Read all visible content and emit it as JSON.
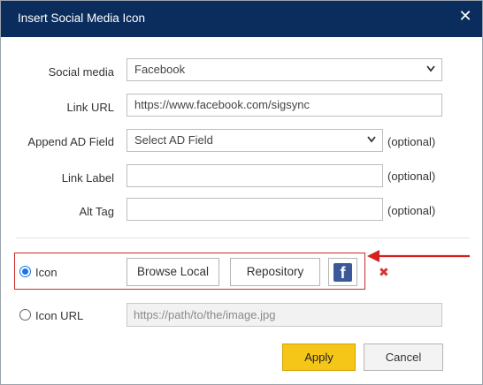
{
  "dialog": {
    "title": "Insert Social Media Icon",
    "close_icon": "close-icon"
  },
  "form": {
    "social_media": {
      "label": "Social media",
      "value": "Facebook"
    },
    "link_url": {
      "label": "Link URL",
      "value": "https://www.facebook.com/sigsync"
    },
    "append_ad_field": {
      "label": "Append AD Field",
      "value": "Select AD Field",
      "note": "(optional)"
    },
    "link_label": {
      "label": "Link Label",
      "value": "",
      "note": "(optional)"
    },
    "alt_tag": {
      "label": "Alt Tag",
      "value": "",
      "note": "(optional)"
    }
  },
  "icon_source": {
    "icon_option": {
      "label": "Icon",
      "selected": true
    },
    "browse_local_label": "Browse Local",
    "repository_label": "Repository",
    "preview_icon": "facebook-icon",
    "preview_glyph": "f",
    "remove_icon": "remove-icon",
    "remove_glyph": "✖",
    "icon_url_option": {
      "label": "Icon URL",
      "selected": false
    },
    "icon_url_placeholder": "https://path/to/the/image.jpg"
  },
  "footer": {
    "apply_label": "Apply",
    "cancel_label": "Cancel"
  },
  "colors": {
    "titlebar": "#0b2d5e",
    "apply": "#f5c518",
    "highlight": "#cc2a2a",
    "facebook": "#3b5998"
  }
}
